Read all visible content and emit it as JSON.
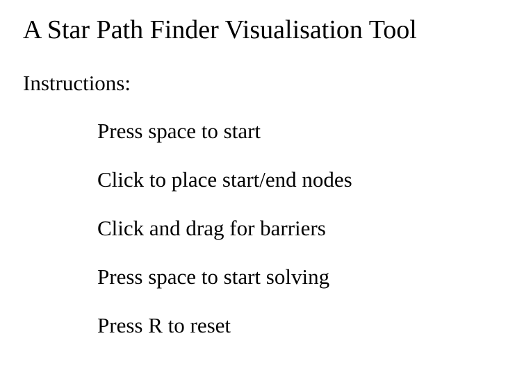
{
  "title": "A Star Path Finder Visualisation Tool",
  "instructions_heading": "Instructions:",
  "instructions": [
    "Press space to start",
    "Click to place start/end nodes",
    "Click and drag for barriers",
    "Press space to start solving",
    "Press R to reset"
  ]
}
